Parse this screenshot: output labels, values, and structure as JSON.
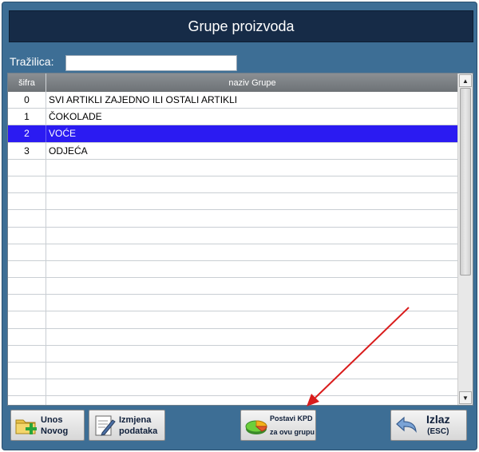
{
  "window": {
    "title": "Grupe proizvoda"
  },
  "search": {
    "label": "Tražilica:",
    "value": ""
  },
  "grid": {
    "columns": {
      "code": "šifra",
      "name": "naziv Grupe"
    },
    "rows": [
      {
        "code": "0",
        "name": "SVI ARTIKLI ZAJEDNO ILI OSTALI ARTIKLI",
        "selected": false
      },
      {
        "code": "1",
        "name": "ČOKOLADE",
        "selected": false
      },
      {
        "code": "2",
        "name": "VOĆE",
        "selected": true
      },
      {
        "code": "3",
        "name": "ODJEĆA",
        "selected": false
      },
      {
        "code": "",
        "name": "",
        "selected": false
      },
      {
        "code": "",
        "name": "",
        "selected": false
      },
      {
        "code": "",
        "name": "",
        "selected": false
      },
      {
        "code": "",
        "name": "",
        "selected": false
      },
      {
        "code": "",
        "name": "",
        "selected": false
      },
      {
        "code": "",
        "name": "",
        "selected": false
      },
      {
        "code": "",
        "name": "",
        "selected": false
      },
      {
        "code": "",
        "name": "",
        "selected": false
      },
      {
        "code": "",
        "name": "",
        "selected": false
      },
      {
        "code": "",
        "name": "",
        "selected": false
      },
      {
        "code": "",
        "name": "",
        "selected": false
      },
      {
        "code": "",
        "name": "",
        "selected": false
      },
      {
        "code": "",
        "name": "",
        "selected": false
      },
      {
        "code": "",
        "name": "",
        "selected": false
      },
      {
        "code": "",
        "name": "",
        "selected": false
      }
    ],
    "scroll_position": 0.0
  },
  "buttons": {
    "unos": {
      "line1": "Unos",
      "line2": "Novog",
      "icon": "folder-add-icon"
    },
    "izmjena": {
      "line1": "Izmjena",
      "line2": "podataka",
      "icon": "edit-document-icon"
    },
    "kpd": {
      "line1": "Postavi KPD",
      "line2": "za ovu grupu",
      "icon": "pie-chart-icon"
    },
    "izlaz": {
      "line1": "Izlaz",
      "line2": "(ESC)",
      "icon": "back-arrow-icon"
    }
  },
  "colors": {
    "title_bar": "#162b47",
    "window_bg": "#3d6e95",
    "selected_row": "#2b1bf2",
    "annotation_arrow": "#d91c1c"
  }
}
